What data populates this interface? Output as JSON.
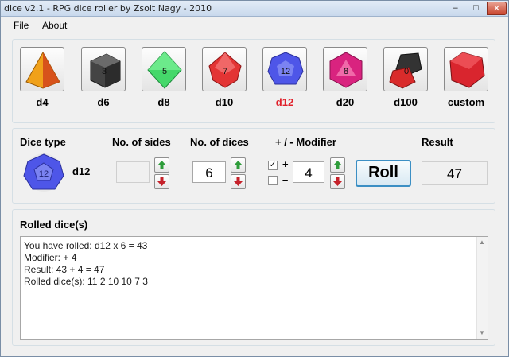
{
  "window": {
    "title": "dice v2.1 - RPG dice roller by Zsolt Nagy - 2010",
    "minimize": "–",
    "maximize": "□",
    "close": "✕"
  },
  "menu": {
    "file": "File",
    "about": "About"
  },
  "dice": [
    {
      "label": "d4",
      "face": "",
      "color": "#f0a11a",
      "icon": "d4-die-icon"
    },
    {
      "label": "d6",
      "face": "3",
      "color": "#444444",
      "icon": "d6-die-icon"
    },
    {
      "label": "d8",
      "face": "5",
      "color": "#45d86a",
      "icon": "d8-die-icon"
    },
    {
      "label": "d10",
      "face": "7",
      "color": "#e33434",
      "icon": "d10-die-icon"
    },
    {
      "label": "d12",
      "face": "12",
      "color": "#4e56e8",
      "icon": "d12-die-icon"
    },
    {
      "label": "d20",
      "face": "8",
      "color": "#d9237f",
      "icon": "d20-die-icon"
    },
    {
      "label": "d100",
      "face": "0",
      "color": "#d92b2b",
      "icon": "d100-die-icon"
    },
    {
      "label": "custom",
      "face": "",
      "color": "#d9252e",
      "icon": "custom-die-icon"
    }
  ],
  "selected_die": "d12",
  "controls": {
    "dice_type_label": "Dice type",
    "dice_type_value": "d12",
    "dice_type_face": "12",
    "sides_label": "No. of sides",
    "sides_value": "",
    "dices_label": "No. of dices",
    "dices_value": "6",
    "modifier_label": "+ / - Modifier",
    "plus_sign": "+",
    "minus_sign": "–",
    "plus_checked": true,
    "minus_checked": false,
    "modifier_value": "4",
    "roll_label": "Roll",
    "result_label": "Result",
    "result_value": "47"
  },
  "rolled": {
    "title": "Rolled dice(s)",
    "lines": [
      "You have rolled: d12 x 6 = 43",
      "Modifier: + 4",
      "Result: 43 + 4 = 47",
      "Rolled dice(s):  11 2 10 10 7 3"
    ]
  }
}
